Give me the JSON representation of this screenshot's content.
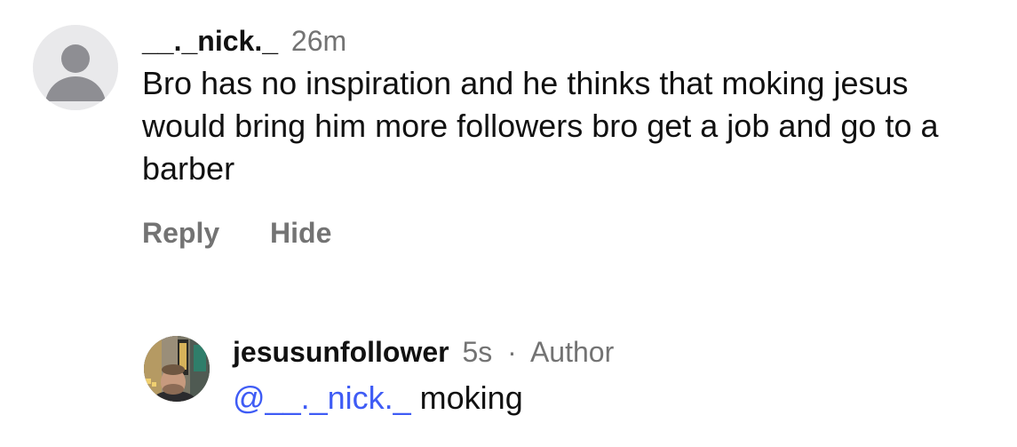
{
  "comment": {
    "username": "__._nick._",
    "time": "26m",
    "text": "Bro has no inspiration and he thinks that moking jesus would bring him more followers bro get a job and go to a barber",
    "actions": {
      "reply_label": "Reply",
      "hide_label": "Hide"
    },
    "avatar_icon": "default-user-avatar-icon"
  },
  "reply": {
    "username": "jesusunfollower",
    "time": "5s",
    "separator": "·",
    "badge": "Author",
    "mention": "@__._nick._",
    "text": " moking",
    "avatar_icon": "profile-photo-avatar"
  },
  "colors": {
    "text_primary": "#111111",
    "text_secondary": "#737373",
    "mention": "#3f5cf5",
    "avatar_bg": "#e9e9eb",
    "avatar_fg": "#8e8e93"
  }
}
